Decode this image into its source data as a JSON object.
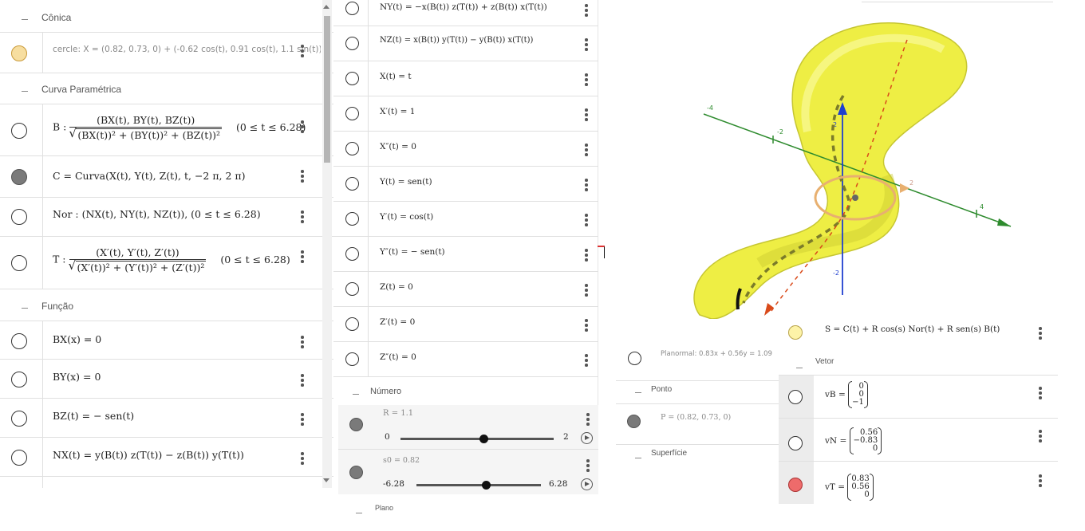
{
  "left_panel": {
    "groups": {
      "conica": "Cônica",
      "curva": "Curva Paramétrica",
      "funcao": "Função"
    },
    "rows": {
      "cercle": "cercle: X = (0.82, 0.73, 0) + (-0.62 cos(t), 0.91 cos(t), 1.1 sin(t))",
      "b_label": "B :",
      "b_num": "(BX(t), BY(t), BZ(t))",
      "b_den": "(BX(t))² + (BY(t))² + (BZ(t))²",
      "b_range": "(0 ≤ t ≤ 6.28)",
      "c_expr": "C = Curva(X(t), Y(t), Z(t), t, −2 π, 2 π)",
      "nor_expr": "Nor : (NX(t), NY(t), NZ(t)),    (0 ≤ t ≤ 6.28)",
      "t_label": "T :",
      "t_num": "(X′(t), Y′(t), Z′(t))",
      "t_den": "(X′(t))² + (Y′(t))² + (Z′(t))²",
      "t_range": "(0 ≤ t ≤ 6.28)",
      "bx": "BX(x) = 0",
      "by": "BY(x) = 0",
      "bz": "BZ(t) = − sen(t)",
      "nx": "NX(t) = y(B(t)) z(T(t)) − z(B(t)) y(T(t))"
    }
  },
  "middle_panel": {
    "rows": [
      "NY(t) = −x(B(t)) z(T(t)) + z(B(t)) x(T(t))",
      "NZ(t) = x(B(t)) y(T(t)) − y(B(t)) x(T(t))",
      "X(t) = t",
      "X′(t) = 1",
      "X″(t) = 0",
      "Y(t) = sen(t)",
      "Y′(t) = cos(t)",
      "Y″(t) = − sen(t)",
      "Z(t) = 0",
      "Z′(t) = 0",
      "Z″(t) = 0"
    ],
    "group_numero": "Número",
    "slider_r": {
      "label": "R = 1.1",
      "min": "0",
      "max": "2",
      "fraction": 0.55
    },
    "slider_s0": {
      "label": "s0 = 0.82",
      "min": "-6.28",
      "max": "6.28",
      "fraction": 0.51
    },
    "group_plano": "Plano"
  },
  "right_panel": {
    "planonormal": "Planormal: 0.83x + 0.56y = 1.09",
    "group_ponto": "Ponto",
    "p_expr": "P = (0.82, 0.73, 0)",
    "group_superficie": "Superfície",
    "s_expr": "S = C(t) + R cos(s) Nor(t) + R sen(s) B(t)",
    "group_vetor": "Vetor",
    "vb": {
      "label": "vB =",
      "values": [
        "0",
        "0",
        "−1"
      ]
    },
    "vn": {
      "label": "vN =",
      "values": [
        "0.56",
        "−0.83",
        "0"
      ]
    },
    "vt": {
      "label": "vT =",
      "values": [
        "0.83",
        "0.56",
        "0"
      ]
    }
  },
  "graphics": {
    "axis_ticks_x": [
      "-4",
      "-2",
      "2",
      "4"
    ],
    "axis_ticks_z": [
      "2",
      "-2"
    ],
    "colors": {
      "surface": "#f0f04a",
      "axis_green": "#2e8b2e",
      "axis_blue": "#1f3fcf",
      "curve_red": "#d94a1a"
    }
  }
}
